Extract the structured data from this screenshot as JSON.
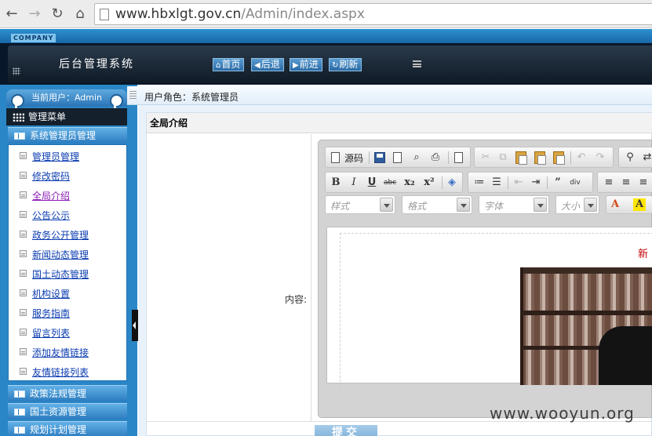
{
  "browser": {
    "url_host": "www.hbxlgt.gov.cn",
    "url_path": "/Admin/index.aspx"
  },
  "header": {
    "company_tag": "COMPANY",
    "title": "后台管理系统",
    "buttons": [
      {
        "label": "首页",
        "icon": "home-icon"
      },
      {
        "label": "后退",
        "icon": "arrow-left-icon"
      },
      {
        "label": "前进",
        "icon": "arrow-right-icon"
      },
      {
        "label": "刷新",
        "icon": "refresh-icon"
      }
    ]
  },
  "sidebar": {
    "current_user": "当前用户：Admin",
    "menu_title": "管理菜单",
    "sections": [
      {
        "label": "系统管理员管理"
      },
      {
        "label": "政策法规管理"
      },
      {
        "label": "国土资源管理"
      },
      {
        "label": "规划计划管理"
      }
    ],
    "items": [
      {
        "label": "管理员管理"
      },
      {
        "label": "修改密码"
      },
      {
        "label": "全局介绍"
      },
      {
        "label": "公告公示"
      },
      {
        "label": "政务公开管理"
      },
      {
        "label": "新闻动态管理"
      },
      {
        "label": "国土动态管理"
      },
      {
        "label": "机构设置"
      },
      {
        "label": "服务指南"
      },
      {
        "label": "留言列表"
      },
      {
        "label": "添加友情链接"
      },
      {
        "label": "友情链接列表"
      }
    ]
  },
  "main": {
    "role_text": "用户角色：系统管理员",
    "form_title": "全局介绍",
    "content_label": "内容:",
    "submit_label": "提交"
  },
  "editor": {
    "source_label": "源码",
    "combos": [
      {
        "placeholder": "样式"
      },
      {
        "placeholder": "格式"
      },
      {
        "placeholder": "字体"
      },
      {
        "placeholder": "大小"
      }
    ],
    "content_title_fragment": "新"
  },
  "watermark": "www.wooyun.org"
}
